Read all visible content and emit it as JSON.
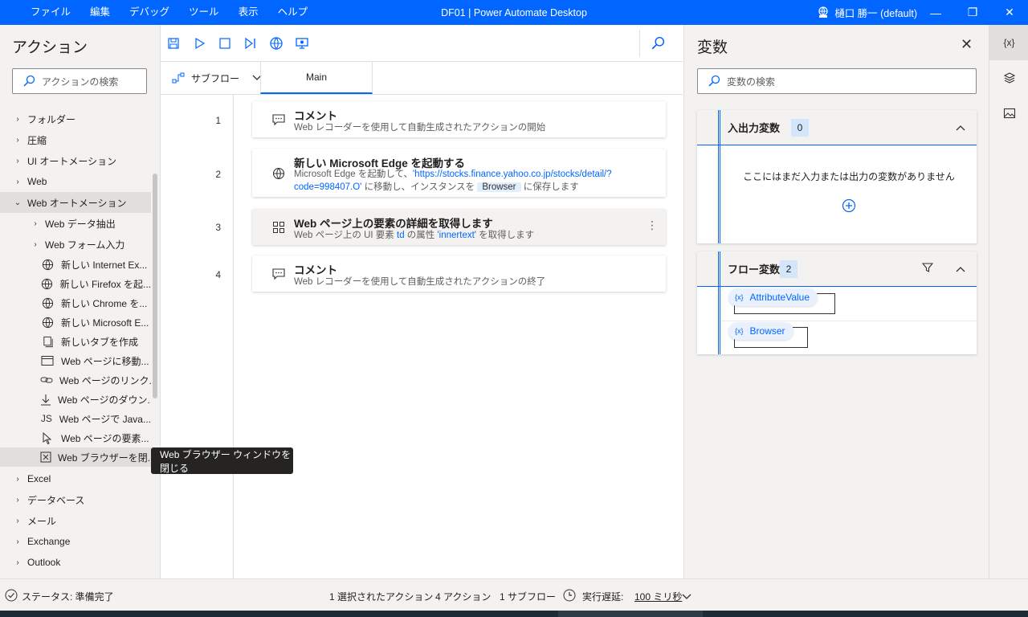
{
  "titlebar": {
    "menu": [
      "ファイル",
      "編集",
      "デバッグ",
      "ツール",
      "表示",
      "ヘルプ"
    ],
    "title": "DF01 | Power Automate Desktop",
    "user": "樋口 勝一 (default)"
  },
  "actions_panel": {
    "title": "アクション",
    "search_placeholder": "アクションの検索",
    "groups_top": [
      "フォルダー",
      "圧縮",
      "UI オートメーション",
      "Web"
    ],
    "expanded_group": "Web オートメーション",
    "subgroups": [
      "Web データ抽出",
      "Web フォーム入力"
    ],
    "leaves": [
      {
        "icon": "globe-icon",
        "label": "新しい Internet Ex..."
      },
      {
        "icon": "globe-icon",
        "label": "新しい Firefox を起..."
      },
      {
        "icon": "globe-icon",
        "label": "新しい Chrome を..."
      },
      {
        "icon": "globe-icon",
        "label": "新しい Microsoft E..."
      },
      {
        "icon": "new-tab-icon",
        "label": "新しいタブを作成"
      },
      {
        "icon": "browser-window-icon",
        "label": "Web ページに移動..."
      },
      {
        "icon": "link-icon",
        "label": "Web ページのリンク..."
      },
      {
        "icon": "download-icon",
        "label": "Web ページのダウン..."
      },
      {
        "icon": "javascript-icon",
        "label": "Web ページで Java..."
      },
      {
        "icon": "cursor-icon",
        "label": "Web ページの要素..."
      },
      {
        "icon": "close-window-icon",
        "label": "Web ブラウザーを閉..."
      }
    ],
    "groups_bottom": [
      "Excel",
      "データベース",
      "メール",
      "Exchange",
      "Outlook"
    ]
  },
  "tooltip": "Web ブラウザー ウィンドウを閉じる",
  "tabs": {
    "subflow_label": "サブフロー",
    "main_tab": "Main"
  },
  "flow": [
    {
      "num": "1",
      "icon": "comment-icon",
      "title": "コメント",
      "desc": "Web レコーダーを使用して自動生成されたアクションの開始"
    },
    {
      "num": "2",
      "icon": "globe-icon",
      "title": "新しい Microsoft Edge を起動する",
      "desc_prefix": "Microsoft Edge を起動して、",
      "url_line1": "'https://stocks.finance.yahoo.co.jp/stocks/detail/?",
      "url_line2": "code=998407.O'",
      "desc_mid": " に移動し、インスタンスを ",
      "var": "Browser",
      "desc_suffix": " に保存します"
    },
    {
      "num": "3",
      "icon": "element-details-icon",
      "title": "Web ページ上の要素の詳細を取得します",
      "desc_a": "Web ページ上の UI 要素 ",
      "td": "td",
      "desc_b": " の属性 ",
      "attr": "'innertext'",
      "desc_c": " を取得します"
    },
    {
      "num": "4",
      "icon": "comment-icon",
      "title": "コメント",
      "desc": "Web レコーダーを使用して自動生成されたアクションの終了"
    }
  ],
  "variables_panel": {
    "title": "変数",
    "search_placeholder": "変数の検索",
    "io_section": {
      "title": "入出力変数",
      "count": "0",
      "empty_text": "ここにはまだ入力または出力の変数がありません"
    },
    "flow_section": {
      "title": "フロー変数",
      "count": "2",
      "vars": [
        "AttributeValue",
        "Browser"
      ]
    }
  },
  "rail": {
    "variables_label": "{x}"
  },
  "status_bar": {
    "status": "ステータス: 準備完了",
    "selected": "1 選択されたアクション",
    "actions": "4 アクション",
    "subflows": "1 サブフロー",
    "delay_label": "実行遅延:",
    "delay_value": "100 ミリ秒"
  },
  "colors": {
    "accent": "#0066ff",
    "panel_bg": "#f3f2f1"
  }
}
